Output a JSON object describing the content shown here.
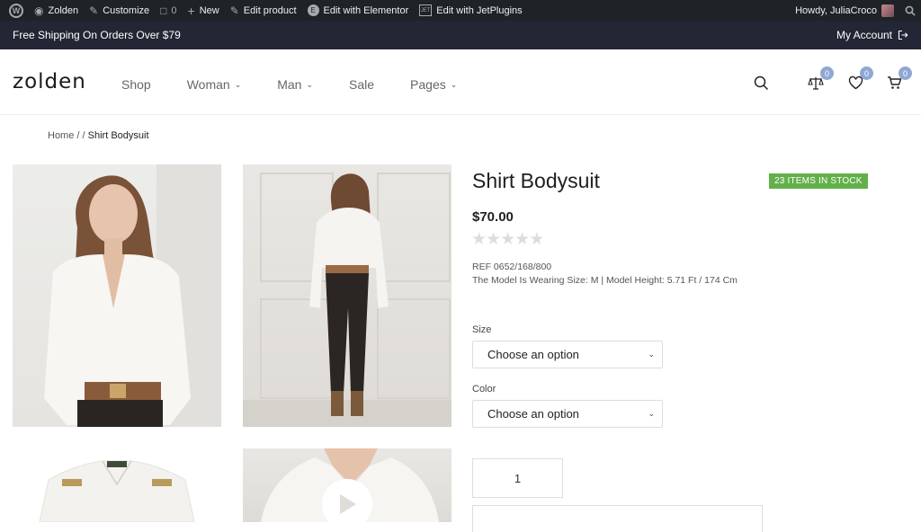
{
  "wp_admin_bar": {
    "site_name": "Zolden",
    "customize": "Customize",
    "comments_count": "0",
    "new": "New",
    "edit_product": "Edit product",
    "edit_elementor": "Edit with Elementor",
    "edit_jetplugins": "Edit with JetPlugins",
    "greeting": "Howdy, JuliaCroco"
  },
  "promo_bar": {
    "text": "Free Shipping On Orders Over $79",
    "account": "My Account"
  },
  "header": {
    "logo": "zolden",
    "nav": [
      "Shop",
      "Woman",
      "Man",
      "Sale",
      "Pages"
    ],
    "compare_count": "0",
    "wishlist_count": "0",
    "cart_count": "0"
  },
  "breadcrumb": {
    "home": "Home",
    "separator": "/",
    "current": "Shirt Bodysuit"
  },
  "product": {
    "title": "Shirt Bodysuit",
    "stock": "23 ITEMS IN STOCK",
    "price": "$70.00",
    "rating_stars": 0,
    "ref": "REF 0652/168/800",
    "model_info": "The Model Is Wearing Size: M | Model Height: 5.71 Ft / 174 Cm",
    "size_label": "Size",
    "size_value": "Choose an option",
    "color_label": "Color",
    "color_value": "Choose an option",
    "quantity": "1"
  },
  "colors": {
    "admin_bar": "#1d2327",
    "promo_bar": "#232634",
    "stock_badge": "#62b04a",
    "header_badge": "#8fa7d2"
  }
}
